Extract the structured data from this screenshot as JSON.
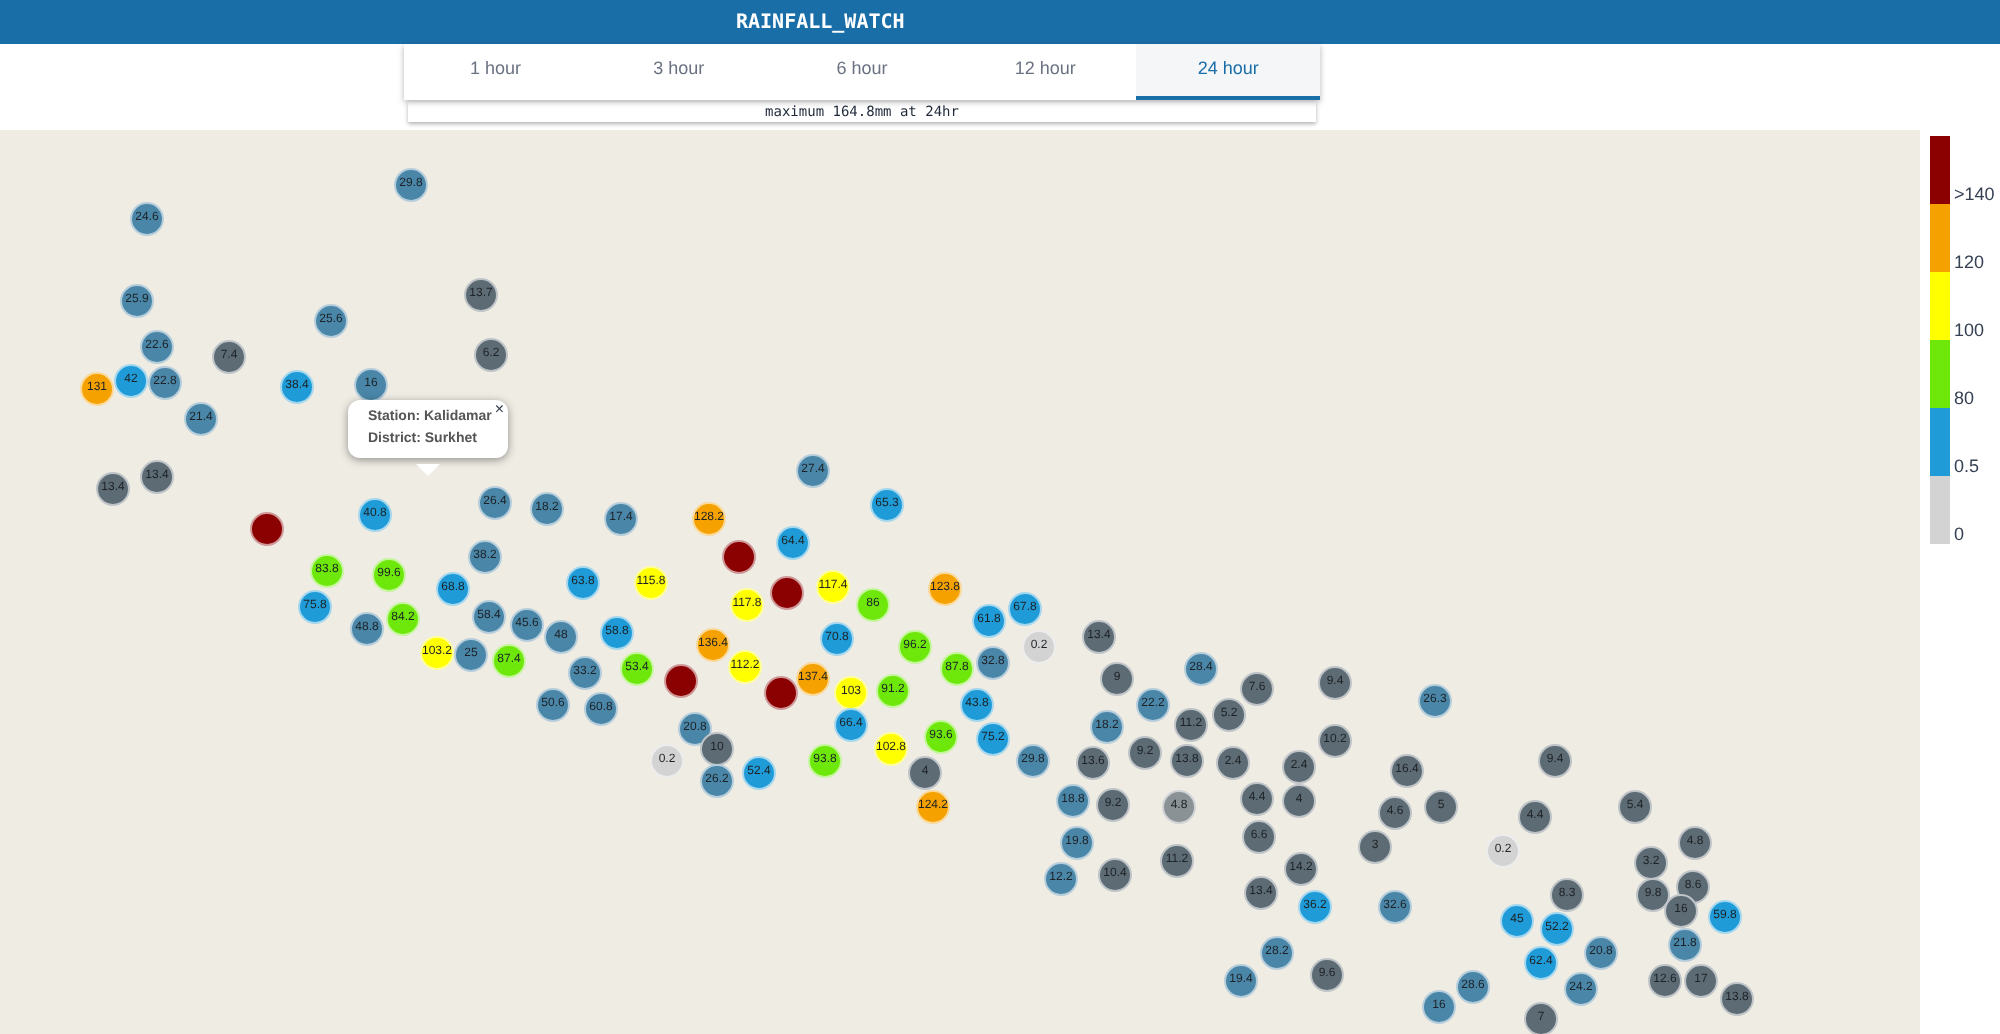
{
  "app_title": "RAINFALL_WATCH",
  "tabs": [
    {
      "label": "1 hour",
      "selected": false
    },
    {
      "label": "3 hour",
      "selected": false
    },
    {
      "label": "6 hour",
      "selected": false
    },
    {
      "label": "12 hour",
      "selected": false
    },
    {
      "label": "24 hour",
      "selected": true
    }
  ],
  "summary": "maximum 164.8mm at 24hr",
  "popup": {
    "station": "Station: Kalidamar",
    "district": "District: Surkhet",
    "close": "×"
  },
  "legend": [
    {
      "label": ">140",
      "color": "#8b0000"
    },
    {
      "label": "120",
      "color": "#f5a100"
    },
    {
      "label": "100",
      "color": "#ffff00"
    },
    {
      "label": "80",
      "color": "#6ee80a"
    },
    {
      "label": "0.5",
      "color": "#1f9bd7"
    },
    {
      "label": "0",
      "color": "#d3d3d3"
    }
  ],
  "markers": [
    {
      "value": "29.8",
      "color": "#4a86a8"
    },
    {
      "value": "24.6",
      "color": "#4a86a8"
    },
    {
      "value": "25.9",
      "color": "#4a86a8"
    },
    {
      "value": "13.7",
      "color": "#5d6b74"
    },
    {
      "value": "25.6",
      "color": "#4a86a8"
    },
    {
      "value": "22.6",
      "color": "#4a86a8"
    },
    {
      "value": "7.4",
      "color": "#5d6b74"
    },
    {
      "value": "6.2",
      "color": "#5d6b74"
    },
    {
      "value": "131",
      "color": "#f5a100"
    },
    {
      "value": "42",
      "color": "#1f9bd7"
    },
    {
      "value": "22.8",
      "color": "#4a86a8"
    },
    {
      "value": "38.4",
      "color": "#1f9bd7"
    },
    {
      "value": "16",
      "color": "#4a86a8"
    },
    {
      "value": "21.4",
      "color": "#4a86a8"
    },
    {
      "value": "13.4",
      "color": "#5d6b74"
    },
    {
      "value": "13.4",
      "color": "#5d6b74"
    },
    {
      "value": "27.4",
      "color": "#4a86a8"
    },
    {
      "color": "#8b0000"
    },
    {
      "value": "40.8",
      "color": "#1f9bd7"
    },
    {
      "value": "26.4",
      "color": "#4a86a8"
    },
    {
      "value": "18.2",
      "color": "#4a86a8"
    },
    {
      "value": "17.4",
      "color": "#4a86a8"
    },
    {
      "value": "128.2",
      "color": "#f5a100"
    },
    {
      "value": "65.3",
      "color": "#1f9bd7"
    },
    {
      "value": "64.4",
      "color": "#1f9bd7"
    },
    {
      "value": "38.2",
      "color": "#4a86a8"
    },
    {
      "color": "#8b0000"
    },
    {
      "value": "83.8",
      "color": "#6ee80a"
    },
    {
      "value": "99.6",
      "color": "#6ee80a"
    },
    {
      "value": "68.8",
      "color": "#1f9bd7"
    },
    {
      "value": "63.8",
      "color": "#1f9bd7"
    },
    {
      "value": "115.8",
      "color": "#ffff00"
    },
    {
      "color": "#8b0000"
    },
    {
      "value": "117.4",
      "color": "#ffff00"
    },
    {
      "value": "123.8",
      "color": "#f5a100"
    },
    {
      "value": "75.8",
      "color": "#1f9bd7"
    },
    {
      "value": "84.2",
      "color": "#6ee80a"
    },
    {
      "value": "58.4",
      "color": "#4a86a8"
    },
    {
      "value": "117.8",
      "color": "#ffff00"
    },
    {
      "value": "86",
      "color": "#6ee80a"
    },
    {
      "value": "61.8",
      "color": "#1f9bd7"
    },
    {
      "value": "67.8",
      "color": "#1f9bd7"
    },
    {
      "value": "48.8",
      "color": "#4a86a8"
    },
    {
      "value": "103.2",
      "color": "#ffff00"
    },
    {
      "value": "45.6",
      "color": "#4a86a8"
    },
    {
      "value": "48",
      "color": "#4a86a8"
    },
    {
      "value": "58.8",
      "color": "#1f9bd7"
    },
    {
      "value": "136.4",
      "color": "#f5a100"
    },
    {
      "value": "70.8",
      "color": "#1f9bd7"
    },
    {
      "value": "96.2",
      "color": "#6ee80a"
    },
    {
      "value": "0.2",
      "color": "#d3d3d3"
    },
    {
      "value": "13.4",
      "color": "#5d6b74"
    },
    {
      "value": "25",
      "color": "#4a86a8"
    },
    {
      "value": "87.4",
      "color": "#6ee80a"
    },
    {
      "value": "33.2",
      "color": "#4a86a8"
    },
    {
      "value": "53.4",
      "color": "#6ee80a"
    },
    {
      "color": "#8b0000"
    },
    {
      "value": "112.2",
      "color": "#ffff00"
    },
    {
      "value": "137.4",
      "color": "#f5a100"
    },
    {
      "value": "87.8",
      "color": "#6ee80a"
    },
    {
      "value": "32.8",
      "color": "#4a86a8"
    },
    {
      "value": "9",
      "color": "#5d6b74"
    },
    {
      "value": "28.4",
      "color": "#4a86a8"
    },
    {
      "value": "9.4",
      "color": "#5d6b74"
    },
    {
      "value": "50.6",
      "color": "#4a86a8"
    },
    {
      "value": "60.8",
      "color": "#4a86a8"
    },
    {
      "color": "#8b0000"
    },
    {
      "value": "103",
      "color": "#ffff00"
    },
    {
      "value": "91.2",
      "color": "#6ee80a"
    },
    {
      "value": "43.8",
      "color": "#1f9bd7"
    },
    {
      "value": "22.2",
      "color": "#4a86a8"
    },
    {
      "value": "5.2",
      "color": "#5d6b74"
    },
    {
      "value": "7.6",
      "color": "#5d6b74"
    },
    {
      "value": "26.3",
      "color": "#4a86a8"
    },
    {
      "value": "20.8",
      "color": "#4a86a8"
    },
    {
      "value": "66.4",
      "color": "#1f9bd7"
    },
    {
      "value": "93.6",
      "color": "#6ee80a"
    },
    {
      "value": "75.2",
      "color": "#1f9bd7"
    },
    {
      "value": "18.2",
      "color": "#4a86a8"
    },
    {
      "value": "11.2",
      "color": "#5d6b74"
    },
    {
      "value": "10.2",
      "color": "#5d6b74"
    },
    {
      "value": "0.2",
      "color": "#d3d3d3"
    },
    {
      "value": "10",
      "color": "#5d6b74"
    },
    {
      "value": "93.8",
      "color": "#6ee80a"
    },
    {
      "value": "102.8",
      "color": "#ffff00"
    },
    {
      "value": "29.8",
      "color": "#4a86a8"
    },
    {
      "value": "13.6",
      "color": "#5d6b74"
    },
    {
      "value": "9.2",
      "color": "#5d6b74"
    },
    {
      "value": "13.8",
      "color": "#5d6b74"
    },
    {
      "value": "2.4",
      "color": "#5d6b74"
    },
    {
      "value": "9.4",
      "color": "#5d6b74"
    },
    {
      "value": "26.2",
      "color": "#4a86a8"
    },
    {
      "value": "52.4",
      "color": "#1f9bd7"
    },
    {
      "value": "4",
      "color": "#5d6b74"
    },
    {
      "value": "2.4",
      "color": "#5d6b74"
    },
    {
      "value": "16.4",
      "color": "#5d6b74"
    },
    {
      "value": "124.2",
      "color": "#f5a100"
    },
    {
      "value": "18.8",
      "color": "#4a86a8"
    },
    {
      "value": "9.2",
      "color": "#5d6b74"
    },
    {
      "value": "4.8",
      "color": "#8a9296"
    },
    {
      "value": "4.4",
      "color": "#5d6b74"
    },
    {
      "value": "4",
      "color": "#5d6b74"
    },
    {
      "value": "4.6",
      "color": "#5d6b74"
    },
    {
      "value": "5",
      "color": "#5d6b74"
    },
    {
      "value": "4.4",
      "color": "#5d6b74"
    },
    {
      "value": "5.4",
      "color": "#5d6b74"
    },
    {
      "value": "19.8",
      "color": "#4a86a8"
    },
    {
      "value": "6.6",
      "color": "#5d6b74"
    },
    {
      "value": "3",
      "color": "#5d6b74"
    },
    {
      "value": "4.8",
      "color": "#5d6b74"
    },
    {
      "value": "12.2",
      "color": "#4a86a8"
    },
    {
      "value": "10.4",
      "color": "#5d6b74"
    },
    {
      "value": "11.2",
      "color": "#5d6b74"
    },
    {
      "value": "14.2",
      "color": "#5d6b74"
    },
    {
      "value": "0.2",
      "color": "#d3d3d3"
    },
    {
      "value": "3.2",
      "color": "#5d6b74"
    },
    {
      "value": "13.4",
      "color": "#5d6b74"
    },
    {
      "value": "8.3",
      "color": "#5d6b74"
    },
    {
      "value": "9.8",
      "color": "#5d6b74"
    },
    {
      "value": "8.6",
      "color": "#5d6b74"
    },
    {
      "value": "36.2",
      "color": "#1f9bd7"
    },
    {
      "value": "32.6",
      "color": "#4a86a8"
    },
    {
      "value": "45",
      "color": "#1f9bd7"
    },
    {
      "value": "52.2",
      "color": "#1f9bd7"
    },
    {
      "value": "16",
      "color": "#5d6b74"
    },
    {
      "value": "59.8",
      "color": "#1f9bd7"
    },
    {
      "value": "28.2",
      "color": "#4a86a8"
    },
    {
      "value": "62.4",
      "color": "#1f9bd7"
    },
    {
      "value": "20.8",
      "color": "#4a86a8"
    },
    {
      "value": "21.8",
      "color": "#4a86a8"
    },
    {
      "value": "19.4",
      "color": "#4a86a8"
    },
    {
      "value": "9.6",
      "color": "#5d6b74"
    },
    {
      "value": "28.6",
      "color": "#4a86a8"
    },
    {
      "value": "24.2",
      "color": "#4a86a8"
    },
    {
      "value": "12.6",
      "color": "#5d6b74"
    },
    {
      "value": "17",
      "color": "#5d6b74"
    },
    {
      "value": "13.8",
      "color": "#5d6b74"
    },
    {
      "value": "16",
      "color": "#4a86a8"
    },
    {
      "value": "7",
      "color": "#5d6b74"
    }
  ]
}
